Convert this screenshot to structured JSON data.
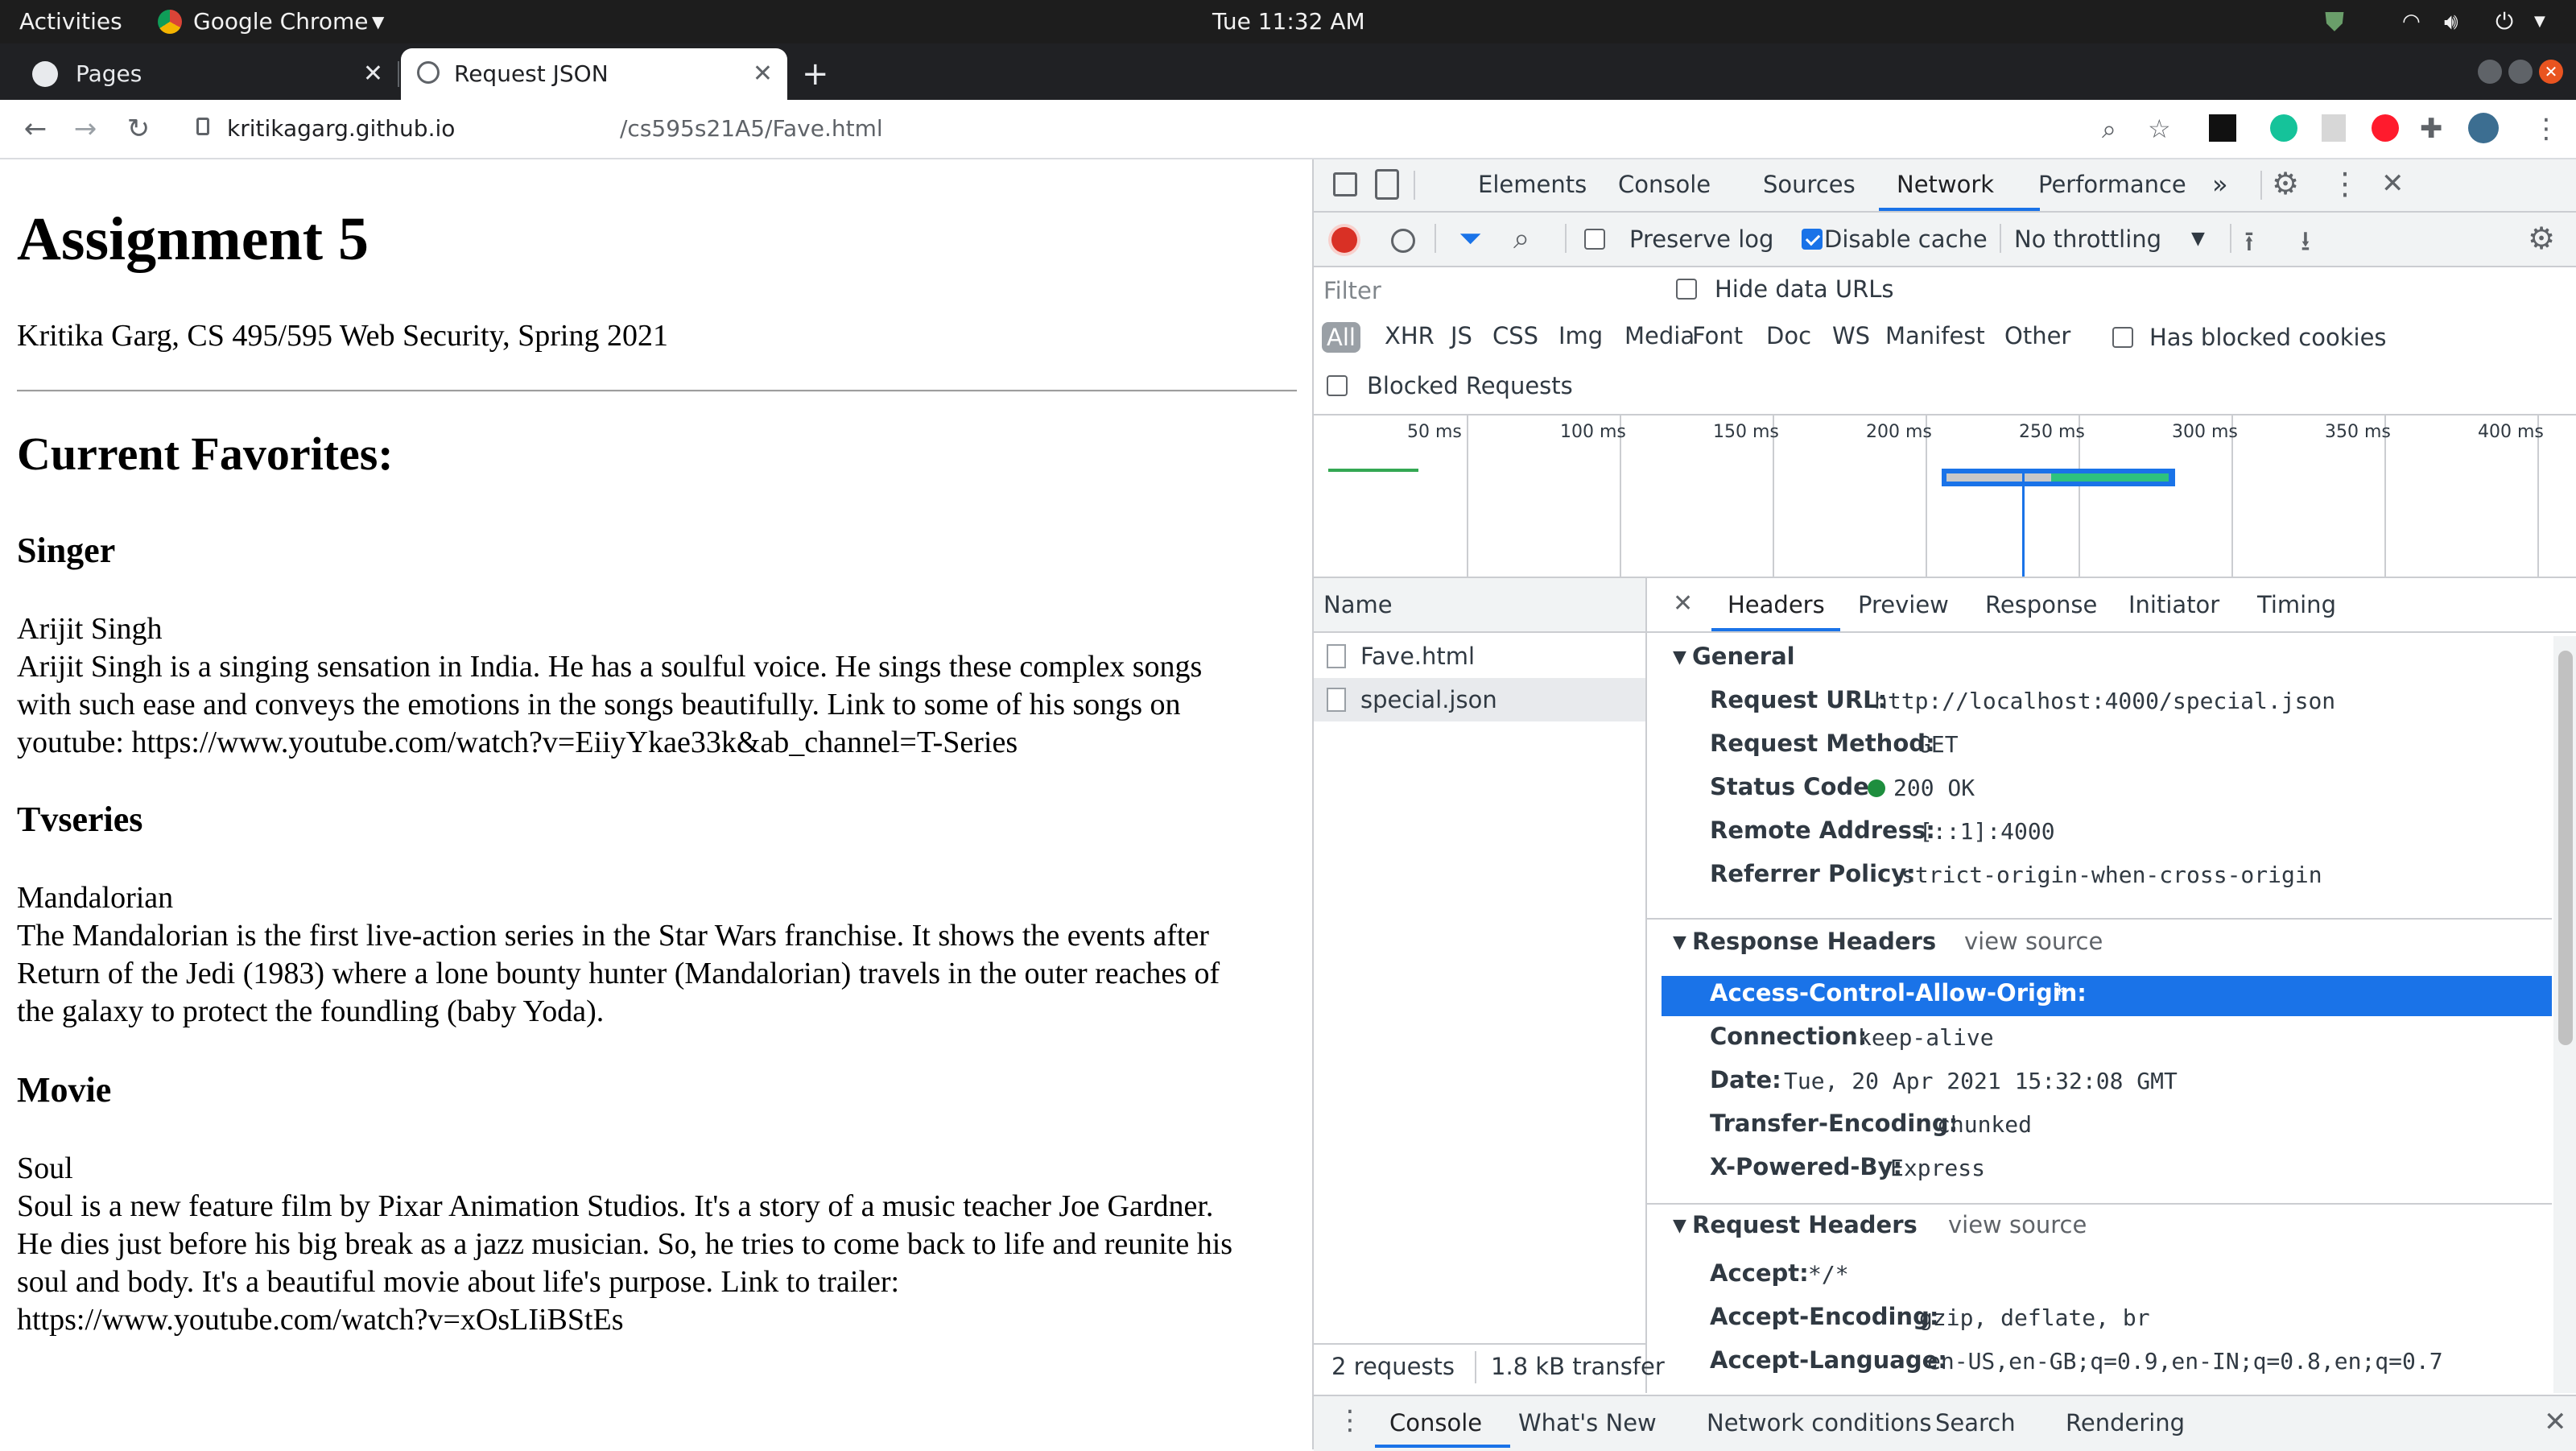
{
  "os": {
    "activities": "Activities",
    "app_name": "Google Chrome",
    "clock": "Tue 11:32 AM"
  },
  "tabs": [
    {
      "title": "Pages",
      "active": false
    },
    {
      "title": "Request JSON",
      "active": true
    }
  ],
  "address": {
    "host": "kritikagarg.github.io",
    "path": "/cs595s21A5/Fave.html"
  },
  "page": {
    "title": "Assignment 5",
    "byline": "Kritika Garg, CS 495/595 Web Security, Spring 2021",
    "favorites_heading": "Current Favorites:",
    "sections": [
      {
        "heading": "Singer",
        "name": "Arijit Singh",
        "lines": [
          "Arijit Singh is a singing sensation in India. He has a soulful voice. He sings these complex songs",
          "with such ease and conveys the emotions in the songs beautifully. Link to some of his songs on",
          "youtube: https://www.youtube.com/watch?v=EiiyYkae33k&ab_channel=T-Series"
        ]
      },
      {
        "heading": "Tvseries",
        "name": "Mandalorian",
        "lines": [
          "The Mandalorian is the first live-action series in the Star Wars franchise. It shows the events after",
          "Return of the Jedi (1983) where a lone bounty hunter (Mandalorian) travels in the outer reaches of",
          "the galaxy to protect the foundling (baby Yoda)."
        ]
      },
      {
        "heading": "Movie",
        "name": "Soul",
        "lines": [
          "Soul is a new feature film by Pixar Animation Studios. It's a story of a music teacher Joe Gardner.",
          "He dies just before his big break as a jazz musician. So, he tries to come back to life and reunite his",
          "soul and body. It's a beautiful movie about life's purpose. Link to trailer:",
          "https://www.youtube.com/watch?v=xOsLIiBStEs"
        ]
      }
    ]
  },
  "devtools": {
    "main_tabs": [
      "Elements",
      "Console",
      "Sources",
      "Network",
      "Performance"
    ],
    "active_main_tab": "Network",
    "more": "»",
    "toolbar": {
      "preserve_log": "Preserve log",
      "preserve_log_checked": false,
      "disable_cache": "Disable cache",
      "disable_cache_checked": true,
      "throttling": "No throttling"
    },
    "filter_placeholder": "Filter",
    "hide_data_urls": "Hide data URLs",
    "type_filters": [
      "All",
      "XHR",
      "JS",
      "CSS",
      "Img",
      "Media",
      "Font",
      "Doc",
      "WS",
      "Manifest",
      "Other"
    ],
    "has_blocked_cookies": "Has blocked cookies",
    "blocked_requests": "Blocked Requests",
    "timeline_ticks": [
      "50 ms",
      "100 ms",
      "150 ms",
      "200 ms",
      "250 ms",
      "300 ms",
      "350 ms",
      "400 ms"
    ],
    "name_header": "Name",
    "requests": [
      "Fave.html",
      "special.json"
    ],
    "selected_request": "special.json",
    "summary": {
      "requests": "2 requests",
      "transfer": "1.8 kB transfer"
    },
    "detail_tabs": [
      "Headers",
      "Preview",
      "Response",
      "Initiator",
      "Timing"
    ],
    "active_detail_tab": "Headers",
    "general": {
      "title": "General",
      "rows": [
        {
          "k": "Request URL:",
          "v": "http://localhost:4000/special.json"
        },
        {
          "k": "Request Method:",
          "v": "GET"
        },
        {
          "k": "Status Code:",
          "v": "200 OK",
          "status_color": "#1e8e3e"
        },
        {
          "k": "Remote Address:",
          "v": "[::1]:4000"
        },
        {
          "k": "Referrer Policy:",
          "v": "strict-origin-when-cross-origin"
        }
      ]
    },
    "response_headers": {
      "title": "Response Headers",
      "view_source": "view source",
      "rows": [
        {
          "k": "Access-Control-Allow-Origin:",
          "v": "*",
          "selected": true
        },
        {
          "k": "Connection:",
          "v": "keep-alive"
        },
        {
          "k": "Date:",
          "v": "Tue, 20 Apr 2021 15:32:08 GMT"
        },
        {
          "k": "Transfer-Encoding:",
          "v": "chunked"
        },
        {
          "k": "X-Powered-By:",
          "v": "Express"
        }
      ]
    },
    "request_headers": {
      "title": "Request Headers",
      "view_source": "view source",
      "rows": [
        {
          "k": "Accept:",
          "v": "*/*"
        },
        {
          "k": "Accept-Encoding:",
          "v": "gzip, deflate, br"
        },
        {
          "k": "Accept-Language:",
          "v": "en-US,en-GB;q=0.9,en-IN;q=0.8,en;q=0.7"
        }
      ]
    },
    "drawer_tabs": [
      "Console",
      "What's New",
      "Network conditions",
      "Search",
      "Rendering"
    ],
    "active_drawer_tab": "Console"
  },
  "colors": {
    "accent": "#1a73e8",
    "selected_row": "#1a73e8",
    "record": "#d93025"
  }
}
